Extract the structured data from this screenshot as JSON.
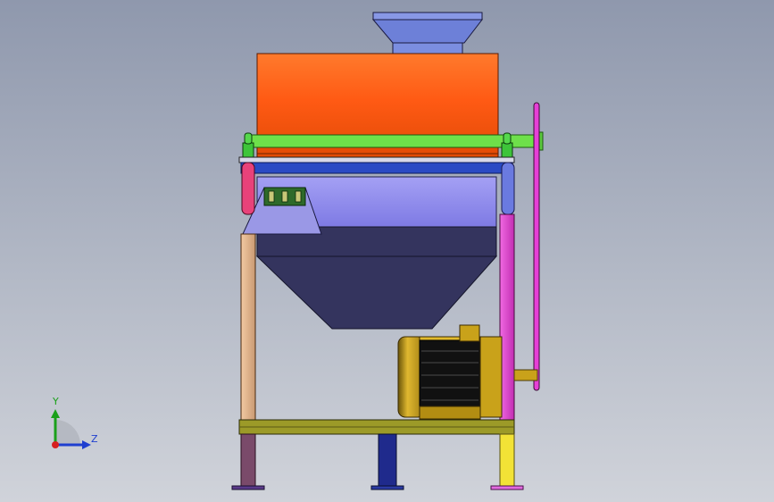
{
  "viewport": {
    "background_top": "#8f98ad",
    "background_bottom": "#d0d3da"
  },
  "triad": {
    "y_label": "Y",
    "z_label": "Z",
    "x_color": "#d62020",
    "y_color": "#1aa01a",
    "z_color": "#1f3fd0"
  },
  "parts": {
    "feed_hopper_color": "#7b8ee0",
    "drum_color": "#ff5a14",
    "shaft_color": "#6ee04a",
    "frame_top_rail_color": "#2a4ac4",
    "collection_bin_upper_color": "#8a86ee",
    "collection_bin_lower_color": "#34345e",
    "discharge_chute_color": "#9a98e6",
    "motor_color": "#c9a21a",
    "motor_fins_color": "#111111",
    "base_rail_color": "#9c9a28",
    "belt_color": "#e63fd6",
    "left_post_upper_color": "#e8427a",
    "left_post_color": "#e3b58f",
    "right_post_color": "#e544d4",
    "foot_left_color": "#7a4a6a",
    "foot_center_color": "#1f2a8c",
    "foot_right_color": "#f2e236"
  }
}
